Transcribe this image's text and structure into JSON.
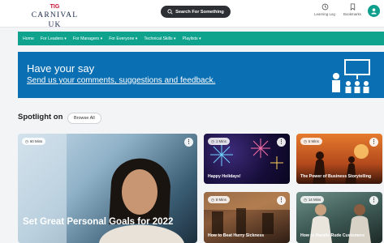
{
  "header": {
    "logo_mark": "TIG",
    "logo_text": "CARNIVAL UK",
    "search_label": "Search For Something",
    "learning_log": "Learning Log",
    "bookmarks": "Bookmarks"
  },
  "nav": {
    "items": [
      {
        "label": "Home"
      },
      {
        "label": "For Leaders ▾"
      },
      {
        "label": "For Managers ▾"
      },
      {
        "label": "For Everyone ▾"
      },
      {
        "label": "Technical Skills ▾"
      },
      {
        "label": "Playlists ▾"
      }
    ]
  },
  "banner": {
    "heading": "Have your say",
    "link": "Send us your comments, suggestions and feedback."
  },
  "spotlight": {
    "title": "Spotlight on",
    "browse_all": "Browse All",
    "cards": [
      {
        "duration": "60 Mins",
        "title": "Set Great Personal Goals for 2022"
      },
      {
        "duration": "1 Mins",
        "title": "Happy Holidays!"
      },
      {
        "duration": "5 Mins",
        "title": "The Power of Business Storytelling"
      },
      {
        "duration": "8 Mins",
        "title": "How to Beat Hurry Sickness"
      },
      {
        "duration": "14 Mins",
        "title": "How to Handle Rude Customers"
      }
    ],
    "more_glyph": "⋮"
  },
  "colors": {
    "accent_teal": "#0fa38e",
    "banner_blue": "#0a6fb3",
    "brand_red": "#c8102e"
  }
}
